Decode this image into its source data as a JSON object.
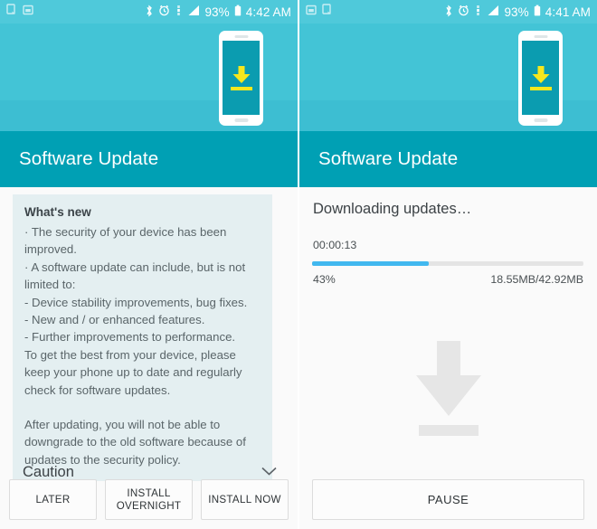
{
  "colors": {
    "hero_teal": "#43c4d6",
    "titlebar_teal": "#00a0b4",
    "statusbar_teal": "#4fc9da",
    "card_bg": "#e4eff1",
    "progress_fill": "#41b8ef",
    "progress_track": "#e4e4e4",
    "arrow_yellow": "#f6e71d",
    "big_arrow_gray": "#e6e6e6",
    "page_bg": "#fafafa"
  },
  "left": {
    "statusbar": {
      "notif_icons": [
        "download-notification-icon",
        "screenshot-notification-icon"
      ],
      "system_icons": [
        "bluetooth-icon",
        "alarm-icon",
        "nfc-icon",
        "signal-bars-icon"
      ],
      "battery_percent": "93%",
      "battery_icon": "battery-full-icon",
      "time": "4:42 AM"
    },
    "hero": {
      "phone_icon": "phone-download-icon"
    },
    "title": "Software Update",
    "whats_new": {
      "heading": "What's new",
      "lines": [
        "· The security of your device has been improved.",
        "· A software update can include, but is not limited to:",
        " - Device stability improvements, bug fixes.",
        " - New and / or enhanced features.",
        " - Further improvements to performance.",
        "To get the best from your device, please keep your phone up to date and regularly check for software updates."
      ],
      "paragraph2": "After updating, you will not be able to downgrade to the old software because of updates to the security policy."
    },
    "caution": {
      "label": "Caution",
      "chevron_icon": "chevron-down-icon"
    },
    "buttons": {
      "later": "LATER",
      "install_overnight": "INSTALL\nOVERNIGHT",
      "install_now": "INSTALL NOW"
    }
  },
  "right": {
    "statusbar": {
      "notif_icons": [
        "screenshot-notification-icon",
        "download-notification-icon"
      ],
      "system_icons": [
        "bluetooth-icon",
        "alarm-icon",
        "nfc-icon",
        "signal-bars-icon"
      ],
      "battery_percent": "93%",
      "battery_icon": "battery-full-icon",
      "time": "4:41 AM"
    },
    "hero": {
      "phone_icon": "phone-download-icon"
    },
    "title": "Software Update",
    "download": {
      "status": "Downloading updates…",
      "elapsed": "00:00:13",
      "percent_label": "43%",
      "percent_value": 43,
      "size": "18.55MB/42.92MB",
      "big_icon": "download-arrow-icon"
    },
    "buttons": {
      "pause": "PAUSE"
    }
  }
}
